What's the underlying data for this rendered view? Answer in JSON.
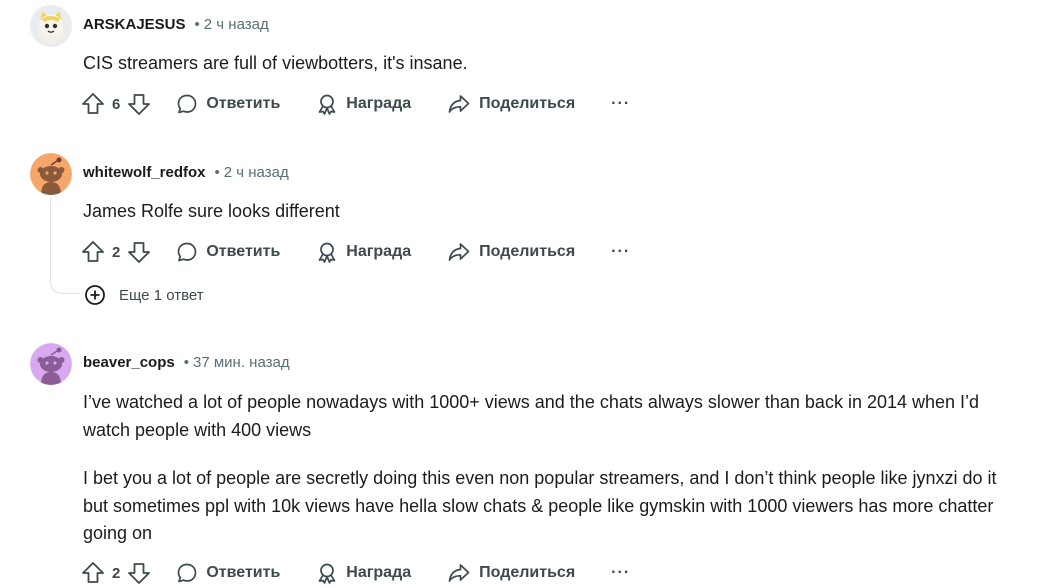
{
  "comments": [
    {
      "author": "ARSKAJESUS",
      "time": "2 ч назад",
      "avatar_color": "#e8eef0",
      "paragraphs": [
        "CIS streamers are full of viewbotters, it's insane."
      ],
      "votes": "6"
    },
    {
      "author": "whitewolf_redfox",
      "time": "2 ч назад",
      "avatar_color": "#f7a66a",
      "paragraphs": [
        "James Rolfe sure looks different"
      ],
      "votes": "2",
      "more_replies": "Еще 1 ответ"
    },
    {
      "author": "beaver_cops",
      "time": "37 мин. назад",
      "avatar_color": "#d8a9ee",
      "paragraphs": [
        "I’ve watched a lot of people nowadays with 1000+ views and the chats always slower than back in 2014 when I’d watch people with 400 views",
        "I bet you a lot of people are secretly doing this even non popular streamers, and I don’t think people like jynxzi do it but sometimes ppl with 10k views have hella slow chats & people like gymskin with 1000 viewers has more chatter going on"
      ],
      "votes": "2"
    }
  ],
  "actions": {
    "reply": "Ответить",
    "award": "Награда",
    "share": "Поделиться",
    "more": "···"
  },
  "icons": {
    "upvote": "upvote-arrow-icon",
    "downvote": "downvote-arrow-icon",
    "reply": "speech-bubble-icon",
    "award": "award-ribbon-icon",
    "share": "share-arrow-icon",
    "expand": "plus-circle-icon"
  },
  "colors": {
    "text": "#1c1c1c",
    "muted": "#576f76",
    "action": "#3c4a50",
    "thread": "#dfe3e6"
  }
}
